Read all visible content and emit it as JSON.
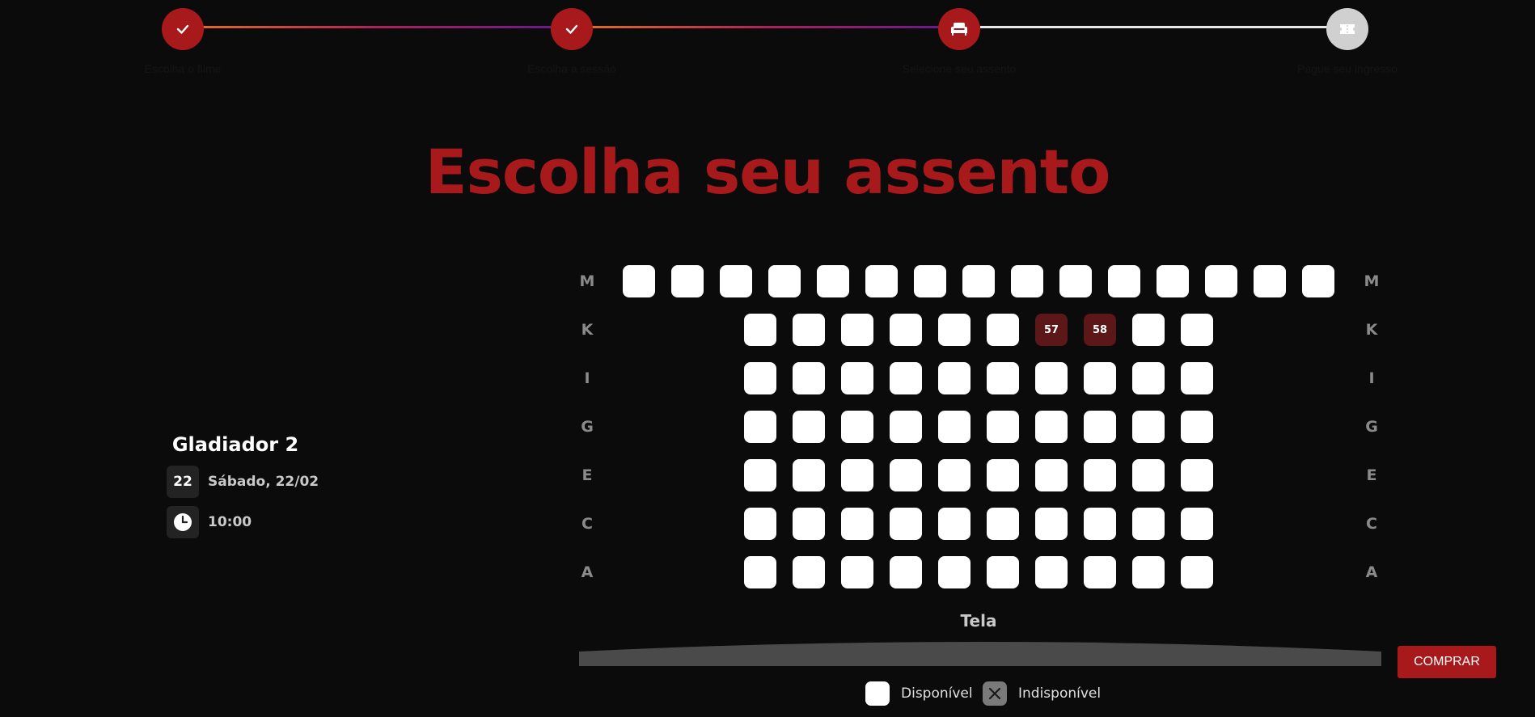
{
  "stepper": {
    "steps": [
      {
        "label": "Escolha o filme",
        "status": "done",
        "icon": "check-icon"
      },
      {
        "label": "Escolha a sessão",
        "status": "done",
        "icon": "check-icon"
      },
      {
        "label": "Selecione seu assento",
        "status": "current",
        "icon": "seat-icon"
      },
      {
        "label": "Pague seu ingresso",
        "status": "todo",
        "icon": "ticket-icon"
      }
    ]
  },
  "page": {
    "title": "Escolha seu assento"
  },
  "movie": {
    "title": "Gladiador 2",
    "day": "22",
    "date": "Sábado, 22/02",
    "time": "10:00"
  },
  "seatmap": {
    "rows": [
      {
        "label": "M",
        "count": 15,
        "labels": [
          "",
          "",
          "",
          "",
          "",
          "",
          "",
          "",
          "",
          "",
          "",
          "",
          "",
          "",
          ""
        ],
        "selected": []
      },
      {
        "label": "K",
        "count": 10,
        "labels": [
          "",
          "",
          "",
          "",
          "",
          "",
          "57",
          "58",
          "",
          ""
        ],
        "selected": [
          6,
          7
        ]
      },
      {
        "label": "I",
        "count": 10,
        "labels": [
          "",
          "",
          "",
          "",
          "",
          "",
          "",
          "",
          "",
          ""
        ],
        "selected": []
      },
      {
        "label": "G",
        "count": 10,
        "labels": [
          "",
          "",
          "",
          "",
          "",
          "",
          "",
          "",
          "",
          ""
        ],
        "selected": []
      },
      {
        "label": "E",
        "count": 10,
        "labels": [
          "",
          "",
          "",
          "",
          "",
          "",
          "",
          "",
          "",
          ""
        ],
        "selected": []
      },
      {
        "label": "C",
        "count": 10,
        "labels": [
          "",
          "",
          "",
          "",
          "",
          "",
          "",
          "",
          "",
          ""
        ],
        "selected": []
      },
      {
        "label": "A",
        "count": 10,
        "labels": [
          "",
          "",
          "",
          "",
          "",
          "",
          "",
          "",
          "",
          ""
        ],
        "selected": []
      }
    ],
    "screen_label": "Tela"
  },
  "actions": {
    "buy_label": "COMPRAR"
  },
  "legend": {
    "available": "Disponível",
    "unavailable": "Indisponível"
  },
  "colors": {
    "accent": "#a8191c",
    "selected_seat": "#5c1719",
    "background": "#0b0b0b"
  }
}
